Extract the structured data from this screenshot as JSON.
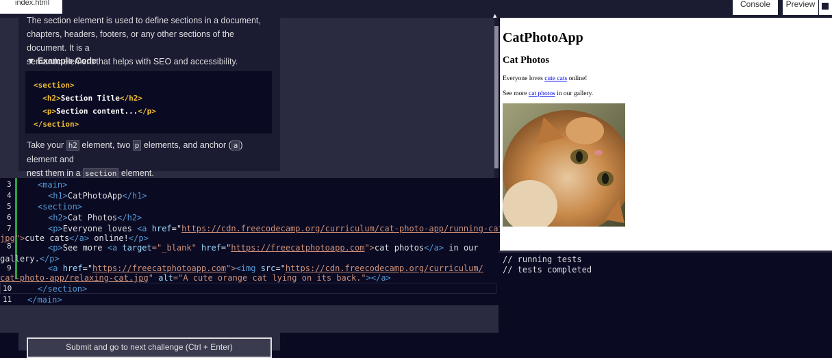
{
  "topbar": {
    "file_tab": "index.html",
    "console_label": "Console",
    "preview_label": "Preview"
  },
  "instructions": {
    "intro_code": "section",
    "intro_lines": [
      "The section element is used to define sections in a document, such as",
      "chapters, headers, footers, or any other sections of the document. It is a",
      "semantic element that helps with SEO and accessibility."
    ],
    "details_summary": "▼ Example Code",
    "example_code": [
      "<section>",
      "  <h2>Section Title</h2>",
      "  <p>Section content...</p>",
      "</section>"
    ],
    "task_line1_a": "Take your",
    "task_code_h2": "h2",
    "task_line1_b": "element, two",
    "task_code_p": "p",
    "task_line1_c": "elements, and anchor (",
    "task_code_a": "a",
    "task_line1_d": ") element and",
    "task_line2_a": "nest them in a",
    "task_code_section": "section",
    "task_line2_b": "element."
  },
  "editor": {
    "line_numbers": [
      "3",
      "4",
      "5",
      "6",
      "7",
      "8",
      "9",
      "10",
      "11"
    ],
    "lines": {
      "l3": "<main>",
      "l4_tag_open": "<h1>",
      "l4_text": "CatPhotoApp",
      "l4_tag_close": "</h1>",
      "l5": "<section>",
      "l6_open": "<h2>",
      "l6_text": "Cat Photos",
      "l6_close": "</h2>",
      "l7_a": "<p>",
      "l7_b": "Everyone loves ",
      "l7_c": "<a ",
      "l7_d": "href",
      "l7_e": "=\"",
      "l7_f": "https://cdn.freecodecamp.org/curriculum/cat-photo-app/running-cats.",
      "l7w_a": "jpg",
      "l7w_b": "\">",
      "l7w_c": "cute cats",
      "l7w_d": "</a>",
      "l7w_e": " online!",
      "l7w_f": "</p>",
      "l8_a": "<p>",
      "l8_b": "See more ",
      "l8_c": "<a ",
      "l8_d": "target",
      "l8_e": "=\"_blank\" ",
      "l8_f": "href",
      "l8_g": "=\"",
      "l8_h": "https://freecatphotoapp.com",
      "l8_i": "\">",
      "l8_j": "cat photos",
      "l8_k": "</a>",
      "l8_l": " in our",
      "l8w_a": "gallery.",
      "l8w_b": "</p>",
      "l9_a": "<a ",
      "l9_b": "href",
      "l9_c": "=\"",
      "l9_d": "https://freecatphotoapp.com",
      "l9_e": "\">",
      "l9_f": "<img ",
      "l9_g": "src",
      "l9_h": "=\"",
      "l9_i": "https://cdn.freecodecamp.org/curriculum/",
      "l9w_a": "cat-photo-app/relaxing-cat.jpg",
      "l9w_b": "\" ",
      "l9w_c": "alt",
      "l9w_d": "=\"A cute orange cat lying on its back.\"",
      "l9w_e": "></a>",
      "l10": "</section>",
      "l11": "</main>"
    }
  },
  "submit_label": "Submit and go to next challenge (Ctrl + Enter)",
  "preview": {
    "h1": "CatPhotoApp",
    "h2": "Cat Photos",
    "p1_before": "Everyone loves ",
    "p1_link": "cute cats",
    "p1_after": " online!",
    "p2_before": "See more ",
    "p2_link": "cat photos",
    "p2_after": " in our gallery.",
    "img_alt": "A cute orange cat lying on its back."
  },
  "console": {
    "lines": [
      "// running tests",
      "// tests completed"
    ]
  },
  "colors": {
    "editor_bg": "#0a0a23",
    "panel_bg": "#1b1b32",
    "tag_yellow": "#f1be32",
    "tag_blue": "#569cd6",
    "string_orange": "#ce9178",
    "gutter_green": "#2ea043"
  }
}
